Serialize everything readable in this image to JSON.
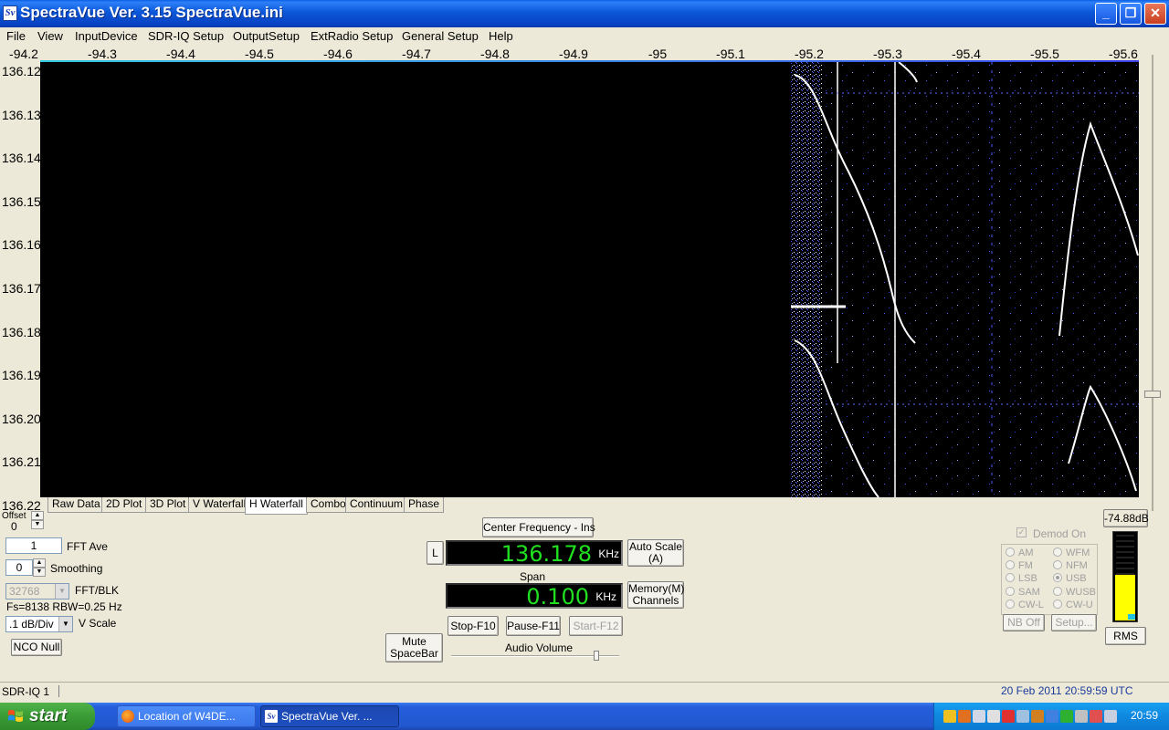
{
  "window": {
    "title": "SpectraVue Ver. 3.15  SpectraVue.ini",
    "icon": "Sv",
    "minimize_glyph": "_",
    "maximize_glyph": "❐",
    "close_glyph": "✕"
  },
  "menu": [
    "File",
    "View",
    "InputDevice",
    "SDR-IQ Setup",
    "OutputSetup",
    "ExtRadio Setup",
    "General Setup",
    "Help"
  ],
  "freq_axis": [
    "-94.2",
    "-94.3",
    "-94.4",
    "-94.5",
    "-94.6",
    "-94.7",
    "-94.8",
    "-94.9",
    "-95",
    "-95.1",
    "-95.2",
    "-95.3",
    "-95.4",
    "-95.5",
    "-95.6"
  ],
  "time_axis": [
    "136.12",
    "136.13",
    "136.14",
    "136.15",
    "136.16",
    "136.17",
    "136.18",
    "136.19",
    "136.20",
    "136.21",
    "136.22"
  ],
  "tabs": [
    "Raw Data",
    "2D Plot",
    "3D Plot",
    "V Waterfall",
    "H Waterfall",
    "Combo",
    "Continuum",
    "Phase"
  ],
  "active_tab": "H Waterfall",
  "left_controls": {
    "offset_label": "Offset",
    "offset_value": "0",
    "fft_ave_value": "1",
    "fft_ave_label": "FFT Ave",
    "smoothing_value": "0",
    "smoothing_label": "Smoothing",
    "fft_blk_value": "32768",
    "fft_blk_label": "FFT/BLK",
    "fs_info": "Fs=8138 RBW=0.25 Hz",
    "vscale_value": ".1 dB/Div",
    "vscale_label": "V Scale",
    "nco_null": "NCO Null"
  },
  "center": {
    "center_freq_button": "Center Frequency - Ins",
    "l_button": "L",
    "freq_value": "136.178",
    "freq_unit": "KHz",
    "auto_scale_line1": "Auto Scale",
    "auto_scale_line2": "(A)",
    "span_label": "Span",
    "span_value": "0.100",
    "span_unit": "KHz",
    "memory_line1": "Memory(M)",
    "memory_line2": "Channels",
    "mute_line1": "Mute",
    "mute_line2": "SpaceBar",
    "stop": "Stop-F10",
    "pause": "Pause-F11",
    "start": "Start-F12",
    "audio_volume": "Audio Volume"
  },
  "demod": {
    "demod_on": "Demod On",
    "modes_left": [
      "AM",
      "FM",
      "LSB",
      "SAM",
      "CW-L"
    ],
    "modes_right": [
      "WFM",
      "NFM",
      "USB",
      "WUSB",
      "CW-U"
    ],
    "selected": "USB",
    "nb_off": "NB Off",
    "setup": "Setup..."
  },
  "meter": {
    "level_label": "-74.88dB",
    "rms": "RMS",
    "fill_fraction": 0.52,
    "fill_color": "#ffff00"
  },
  "status": {
    "device": "SDR-IQ 1",
    "datetime": "20 Feb 2011   20:59:59 UTC"
  },
  "taskbar": {
    "start": "start",
    "tasks": [
      {
        "label": "Location of W4DE...",
        "icon": "firefox-icon",
        "active": false
      },
      {
        "label": "SpectraVue Ver. ...",
        "icon": "spectravue-icon",
        "active": true
      }
    ],
    "clock": "20:59"
  }
}
